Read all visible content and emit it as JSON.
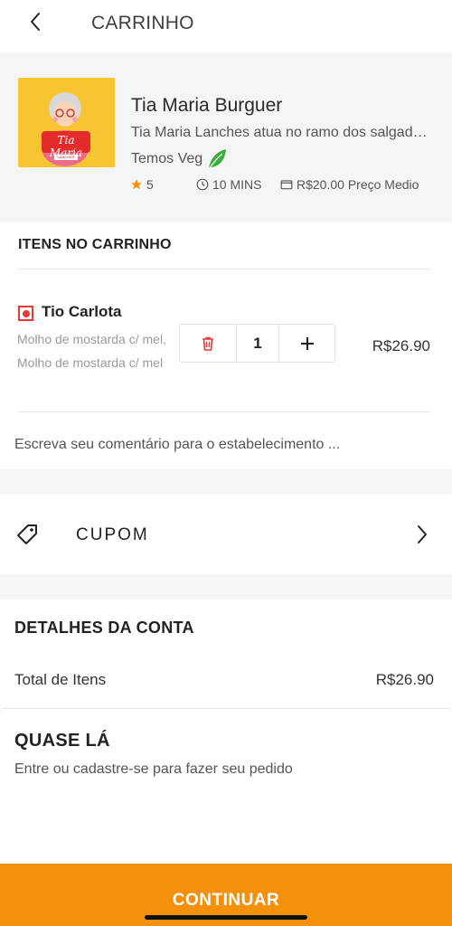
{
  "header": {
    "title": "CARRINHO",
    "back_icon": "chevron-left-icon"
  },
  "store": {
    "name": "Tia Maria Burguer",
    "description": "Tia Maria Lanches atua no ramo dos salgados e lanches",
    "veg_label": "Temos Veg",
    "logo_text": "Tia Maria",
    "logo_subtext": "LANCHES",
    "rating": "5",
    "delivery_time": "10 MINS",
    "avg_price": "R$20.00 Preço Medio"
  },
  "cart": {
    "section_title": "ITENS NO CARRINHO",
    "items": [
      {
        "name": "Tio Carlota",
        "options": "Molho de mostarda c/ mel, Molho de mostarda c/ mel",
        "quantity": "1",
        "price": "R$26.90"
      }
    ],
    "comment_placeholder": "Escreva seu comentário para o estabelecimento ..."
  },
  "coupon": {
    "label": "CUPOM"
  },
  "bill": {
    "title": "DETALHES DA CONTA",
    "total_items_label": "Total de Itens",
    "total_items_value": "R$26.90"
  },
  "login_prompt": {
    "title": "QUASE LÁ",
    "subtitle": "Entre ou cadastre-se para fazer seu pedido"
  },
  "footer": {
    "continue_label": "CONTINUAR"
  },
  "colors": {
    "accent": "#f5900b",
    "veg_red": "#e53935",
    "star": "#f5900b",
    "leaf": "#3cae3c"
  }
}
